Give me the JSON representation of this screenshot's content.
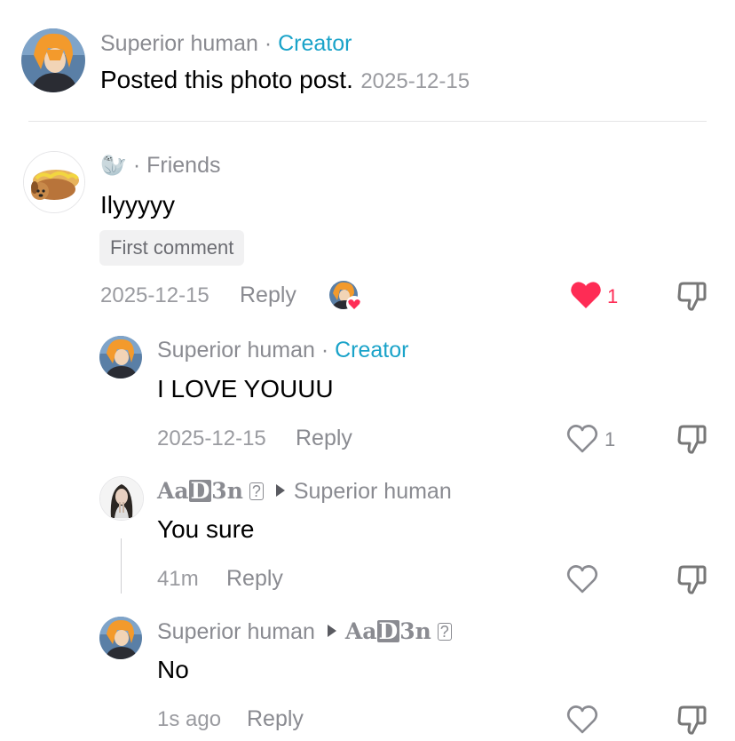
{
  "post": {
    "author": "Superior human",
    "separator": " · ",
    "role": "Creator",
    "text": "Posted this photo post.",
    "date": "2025-12-15"
  },
  "comment": {
    "emoji": "🦭",
    "separator": " · ",
    "tag": "Friends",
    "text": "Ilyyyyy",
    "badge": "First comment",
    "date": "2025-12-15",
    "reply_label": "Reply",
    "likes": "1"
  },
  "replies": [
    {
      "author": "Superior human",
      "separator": " · ",
      "role": "Creator",
      "text": "I LOVE YOUUU",
      "time": "2025-12-15",
      "reply_label": "Reply",
      "likes": "1"
    },
    {
      "author_a": "Aa",
      "author_d": "D",
      "author_b": "3n",
      "author_box": "?",
      "to": "Superior human",
      "text": "You sure",
      "time": "41m",
      "reply_label": "Reply"
    },
    {
      "author": "Superior human",
      "to_a": "Aa",
      "to_d": "D",
      "to_b": "3n",
      "to_box": "?",
      "text": "No",
      "time": "1s ago",
      "reply_label": "Reply"
    }
  ],
  "colors": {
    "accent": "#1aa3c9",
    "like_red": "#fe2c55",
    "muted": "#8a8b91"
  },
  "icons": [
    "heart-icon",
    "dislike-icon",
    "avatar"
  ]
}
